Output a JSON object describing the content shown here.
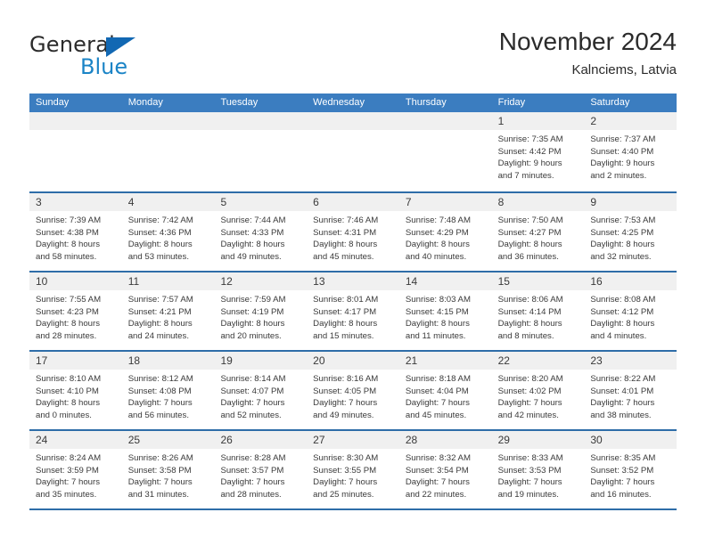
{
  "brand": {
    "name_part1": "General",
    "name_part2": "Blue",
    "triangle_color": "#1268b3",
    "blue_color": "#1b84c6"
  },
  "header": {
    "title": "November 2024",
    "subtitle": "Kalnciems, Latvia"
  },
  "theme": {
    "header_bg": "#3b7dc0",
    "row_border": "#2e6da8",
    "day_band_bg": "#f0f0f0",
    "text": "#3a3a3a"
  },
  "weekdays": [
    "Sunday",
    "Monday",
    "Tuesday",
    "Wednesday",
    "Thursday",
    "Friday",
    "Saturday"
  ],
  "weeks": [
    [
      {
        "day": "",
        "empty": true
      },
      {
        "day": "",
        "empty": true
      },
      {
        "day": "",
        "empty": true
      },
      {
        "day": "",
        "empty": true
      },
      {
        "day": "",
        "empty": true
      },
      {
        "day": "1",
        "sunrise": "Sunrise: 7:35 AM",
        "sunset": "Sunset: 4:42 PM",
        "daylight1": "Daylight: 9 hours",
        "daylight2": "and 7 minutes."
      },
      {
        "day": "2",
        "sunrise": "Sunrise: 7:37 AM",
        "sunset": "Sunset: 4:40 PM",
        "daylight1": "Daylight: 9 hours",
        "daylight2": "and 2 minutes."
      }
    ],
    [
      {
        "day": "3",
        "sunrise": "Sunrise: 7:39 AM",
        "sunset": "Sunset: 4:38 PM",
        "daylight1": "Daylight: 8 hours",
        "daylight2": "and 58 minutes."
      },
      {
        "day": "4",
        "sunrise": "Sunrise: 7:42 AM",
        "sunset": "Sunset: 4:36 PM",
        "daylight1": "Daylight: 8 hours",
        "daylight2": "and 53 minutes."
      },
      {
        "day": "5",
        "sunrise": "Sunrise: 7:44 AM",
        "sunset": "Sunset: 4:33 PM",
        "daylight1": "Daylight: 8 hours",
        "daylight2": "and 49 minutes."
      },
      {
        "day": "6",
        "sunrise": "Sunrise: 7:46 AM",
        "sunset": "Sunset: 4:31 PM",
        "daylight1": "Daylight: 8 hours",
        "daylight2": "and 45 minutes."
      },
      {
        "day": "7",
        "sunrise": "Sunrise: 7:48 AM",
        "sunset": "Sunset: 4:29 PM",
        "daylight1": "Daylight: 8 hours",
        "daylight2": "and 40 minutes."
      },
      {
        "day": "8",
        "sunrise": "Sunrise: 7:50 AM",
        "sunset": "Sunset: 4:27 PM",
        "daylight1": "Daylight: 8 hours",
        "daylight2": "and 36 minutes."
      },
      {
        "day": "9",
        "sunrise": "Sunrise: 7:53 AM",
        "sunset": "Sunset: 4:25 PM",
        "daylight1": "Daylight: 8 hours",
        "daylight2": "and 32 minutes."
      }
    ],
    [
      {
        "day": "10",
        "sunrise": "Sunrise: 7:55 AM",
        "sunset": "Sunset: 4:23 PM",
        "daylight1": "Daylight: 8 hours",
        "daylight2": "and 28 minutes."
      },
      {
        "day": "11",
        "sunrise": "Sunrise: 7:57 AM",
        "sunset": "Sunset: 4:21 PM",
        "daylight1": "Daylight: 8 hours",
        "daylight2": "and 24 minutes."
      },
      {
        "day": "12",
        "sunrise": "Sunrise: 7:59 AM",
        "sunset": "Sunset: 4:19 PM",
        "daylight1": "Daylight: 8 hours",
        "daylight2": "and 20 minutes."
      },
      {
        "day": "13",
        "sunrise": "Sunrise: 8:01 AM",
        "sunset": "Sunset: 4:17 PM",
        "daylight1": "Daylight: 8 hours",
        "daylight2": "and 15 minutes."
      },
      {
        "day": "14",
        "sunrise": "Sunrise: 8:03 AM",
        "sunset": "Sunset: 4:15 PM",
        "daylight1": "Daylight: 8 hours",
        "daylight2": "and 11 minutes."
      },
      {
        "day": "15",
        "sunrise": "Sunrise: 8:06 AM",
        "sunset": "Sunset: 4:14 PM",
        "daylight1": "Daylight: 8 hours",
        "daylight2": "and 8 minutes."
      },
      {
        "day": "16",
        "sunrise": "Sunrise: 8:08 AM",
        "sunset": "Sunset: 4:12 PM",
        "daylight1": "Daylight: 8 hours",
        "daylight2": "and 4 minutes."
      }
    ],
    [
      {
        "day": "17",
        "sunrise": "Sunrise: 8:10 AM",
        "sunset": "Sunset: 4:10 PM",
        "daylight1": "Daylight: 8 hours",
        "daylight2": "and 0 minutes."
      },
      {
        "day": "18",
        "sunrise": "Sunrise: 8:12 AM",
        "sunset": "Sunset: 4:08 PM",
        "daylight1": "Daylight: 7 hours",
        "daylight2": "and 56 minutes."
      },
      {
        "day": "19",
        "sunrise": "Sunrise: 8:14 AM",
        "sunset": "Sunset: 4:07 PM",
        "daylight1": "Daylight: 7 hours",
        "daylight2": "and 52 minutes."
      },
      {
        "day": "20",
        "sunrise": "Sunrise: 8:16 AM",
        "sunset": "Sunset: 4:05 PM",
        "daylight1": "Daylight: 7 hours",
        "daylight2": "and 49 minutes."
      },
      {
        "day": "21",
        "sunrise": "Sunrise: 8:18 AM",
        "sunset": "Sunset: 4:04 PM",
        "daylight1": "Daylight: 7 hours",
        "daylight2": "and 45 minutes."
      },
      {
        "day": "22",
        "sunrise": "Sunrise: 8:20 AM",
        "sunset": "Sunset: 4:02 PM",
        "daylight1": "Daylight: 7 hours",
        "daylight2": "and 42 minutes."
      },
      {
        "day": "23",
        "sunrise": "Sunrise: 8:22 AM",
        "sunset": "Sunset: 4:01 PM",
        "daylight1": "Daylight: 7 hours",
        "daylight2": "and 38 minutes."
      }
    ],
    [
      {
        "day": "24",
        "sunrise": "Sunrise: 8:24 AM",
        "sunset": "Sunset: 3:59 PM",
        "daylight1": "Daylight: 7 hours",
        "daylight2": "and 35 minutes."
      },
      {
        "day": "25",
        "sunrise": "Sunrise: 8:26 AM",
        "sunset": "Sunset: 3:58 PM",
        "daylight1": "Daylight: 7 hours",
        "daylight2": "and 31 minutes."
      },
      {
        "day": "26",
        "sunrise": "Sunrise: 8:28 AM",
        "sunset": "Sunset: 3:57 PM",
        "daylight1": "Daylight: 7 hours",
        "daylight2": "and 28 minutes."
      },
      {
        "day": "27",
        "sunrise": "Sunrise: 8:30 AM",
        "sunset": "Sunset: 3:55 PM",
        "daylight1": "Daylight: 7 hours",
        "daylight2": "and 25 minutes."
      },
      {
        "day": "28",
        "sunrise": "Sunrise: 8:32 AM",
        "sunset": "Sunset: 3:54 PM",
        "daylight1": "Daylight: 7 hours",
        "daylight2": "and 22 minutes."
      },
      {
        "day": "29",
        "sunrise": "Sunrise: 8:33 AM",
        "sunset": "Sunset: 3:53 PM",
        "daylight1": "Daylight: 7 hours",
        "daylight2": "and 19 minutes."
      },
      {
        "day": "30",
        "sunrise": "Sunrise: 8:35 AM",
        "sunset": "Sunset: 3:52 PM",
        "daylight1": "Daylight: 7 hours",
        "daylight2": "and 16 minutes."
      }
    ]
  ]
}
